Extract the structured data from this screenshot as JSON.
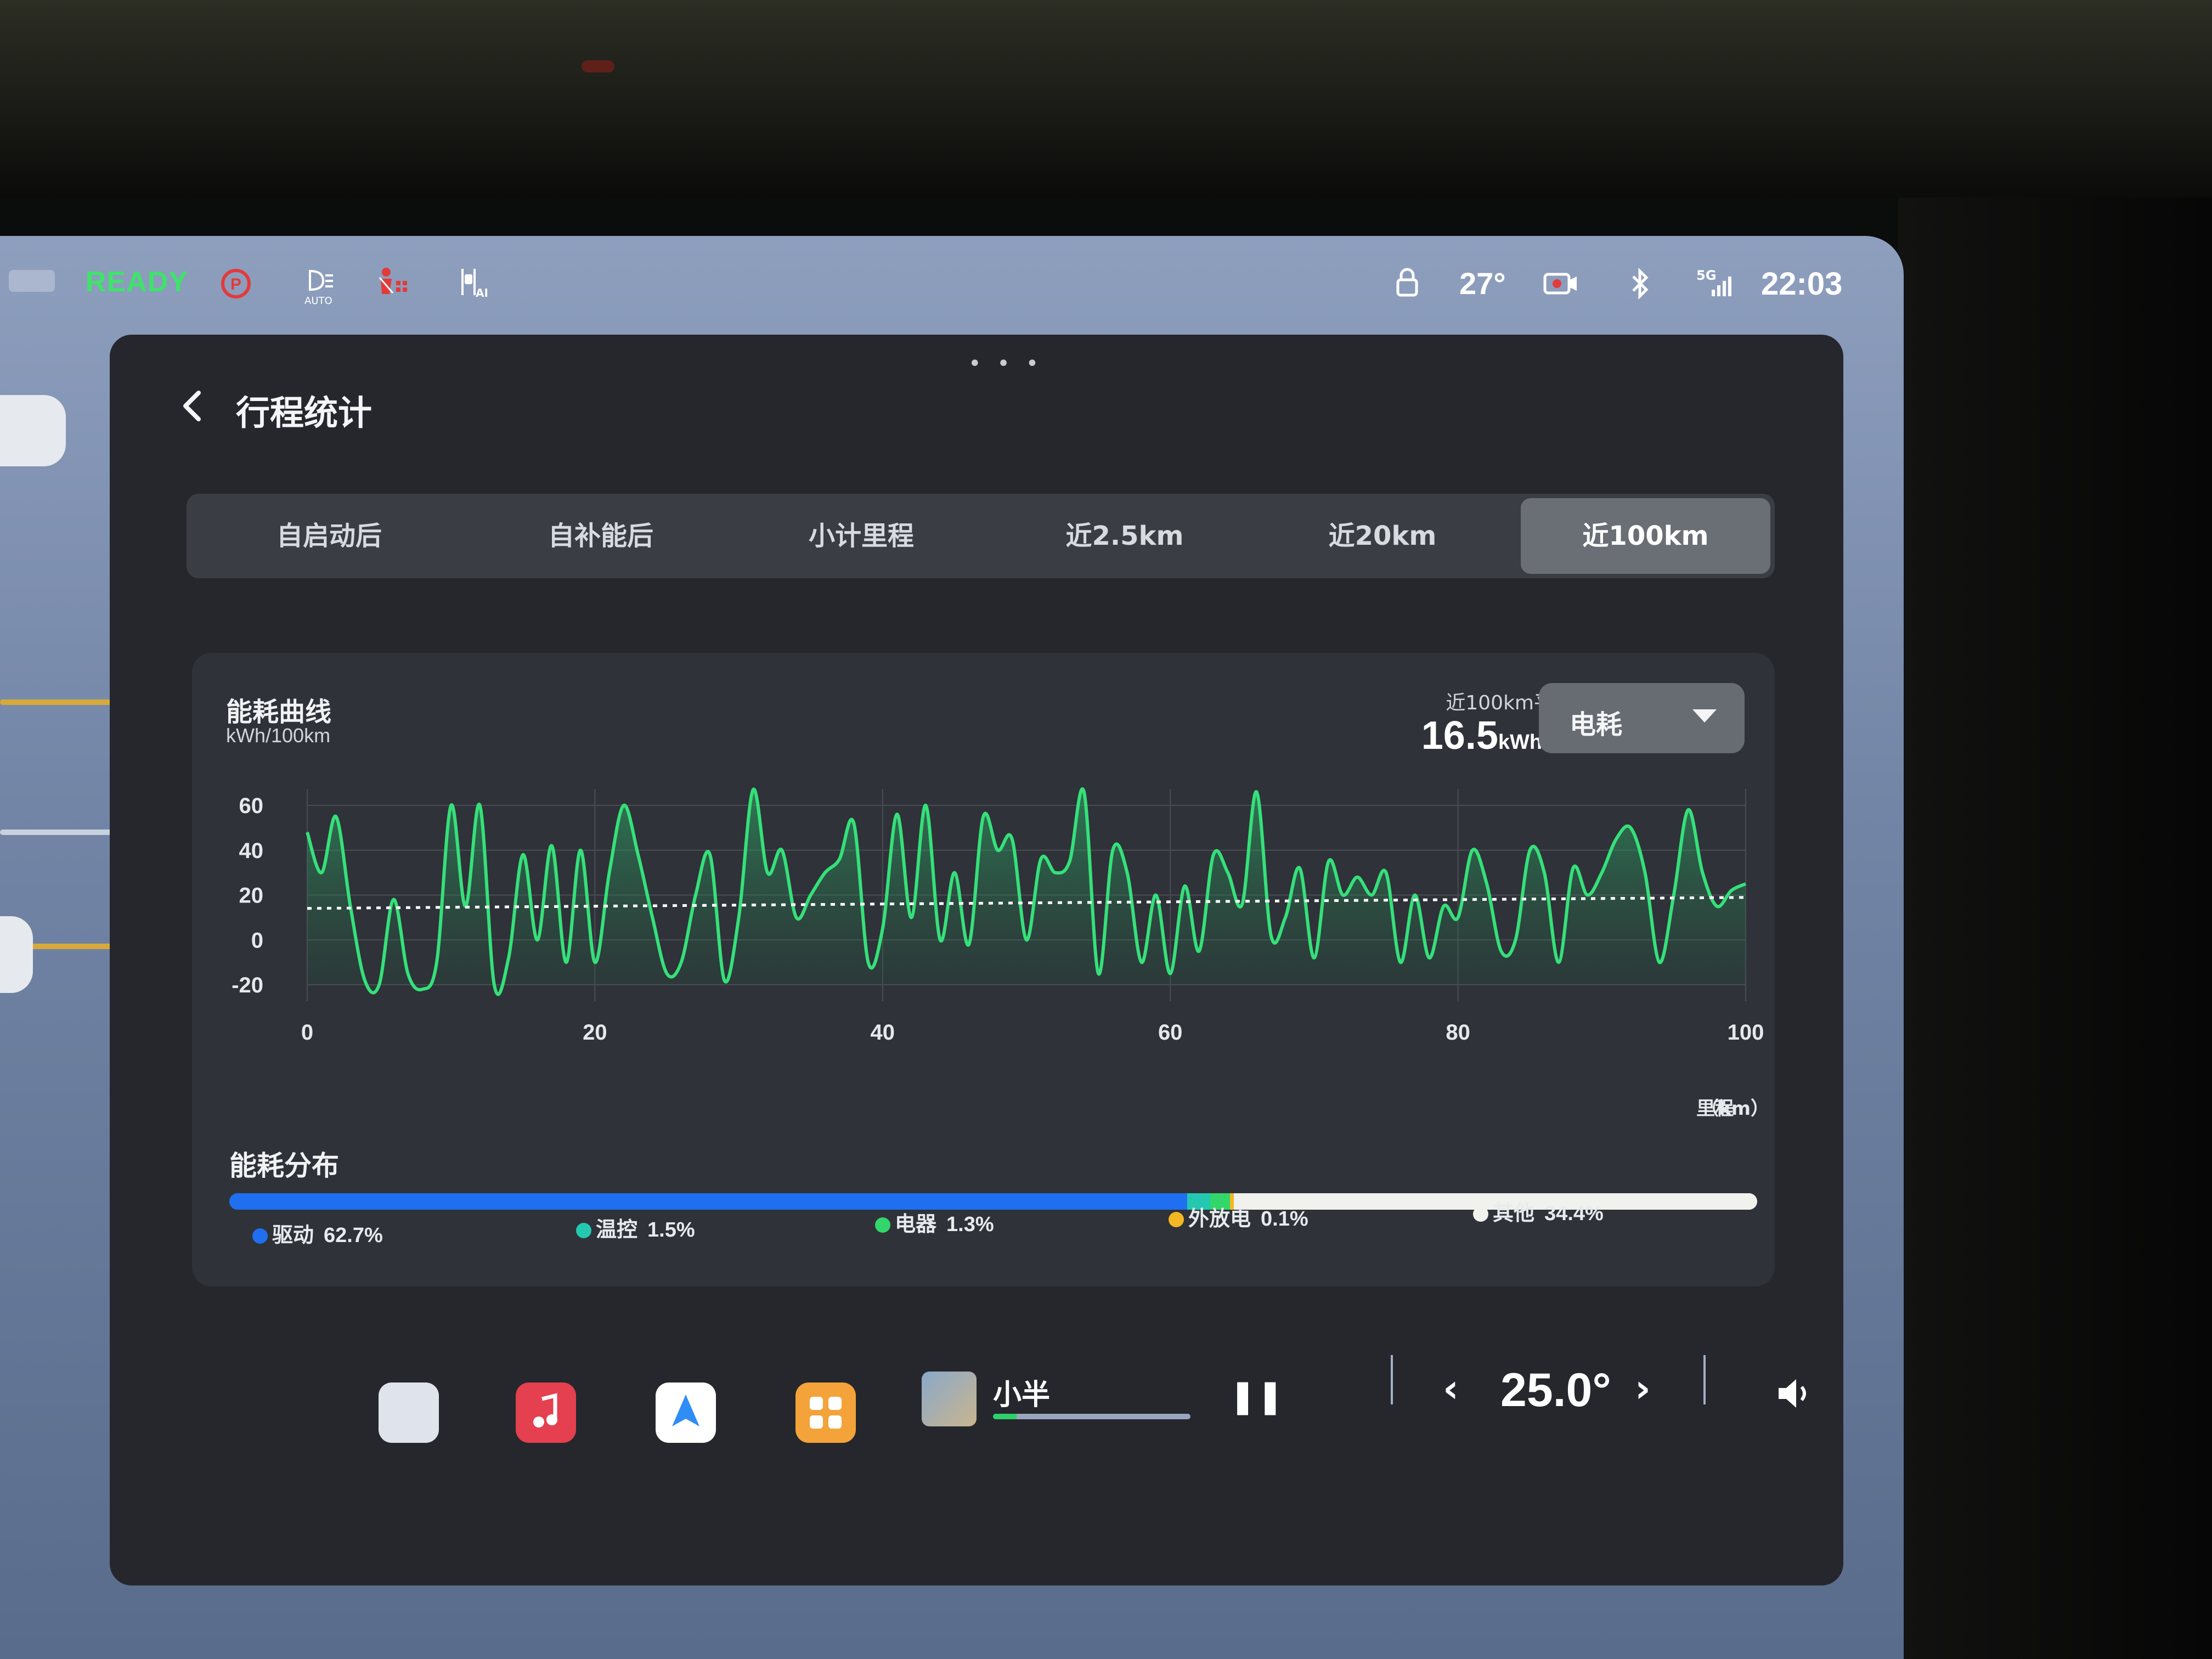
{
  "status_bar": {
    "ready": "READY",
    "park_icon": "park-brake-icon",
    "headlight_icon": "auto-headlight-icon",
    "headlight_badge": "AUTO",
    "seatbelt_icon": "seatbelt-warning-icon",
    "assist_icon": "driving-assist-icon",
    "assist_badge": "AI",
    "lock_icon": "lock-icon",
    "outside_temp": "27°",
    "camera_icon": "dashcam-icon",
    "bluetooth_icon": "bluetooth-icon",
    "signal_label": "5G",
    "clock": "22:03",
    "colors": {
      "ready": "#3fe36a",
      "park": "#e33a3a"
    }
  },
  "header": {
    "back_icon": "chevron-left-icon",
    "title": "行程统计"
  },
  "tabs": [
    {
      "label": "自启动后",
      "active": false
    },
    {
      "label": "自补能后",
      "active": false
    },
    {
      "label": "小计里程",
      "active": false
    },
    {
      "label": "近2.5km",
      "active": false
    },
    {
      "label": "近20km",
      "active": false
    },
    {
      "label": "近100km",
      "active": true
    }
  ],
  "energy_card": {
    "title": "能耗曲线",
    "unit": "kWh/100km",
    "avg_label": "近100km平均电耗",
    "avg_value": "16.5",
    "avg_unit": "kWh/100km",
    "dropdown": {
      "label": "电耗",
      "icon": "caret-down-icon"
    }
  },
  "chart_data": {
    "type": "area",
    "x_label": "里程（km）",
    "x_axis_title": "里程",
    "x_axis_unit": "（km）",
    "y_unit": "kWh/100km",
    "xlim": [
      0,
      100
    ],
    "ylim": [
      -20,
      60
    ],
    "x_ticks": [
      "0",
      "20",
      "40",
      "60",
      "80",
      "100"
    ],
    "y_ticks": [
      "60",
      "40",
      "20",
      "0",
      "-20"
    ],
    "average": 16.5,
    "line_color": "#35e07a",
    "x": [
      0,
      1,
      2,
      3,
      4,
      5,
      6,
      7,
      8,
      9,
      10,
      11,
      12,
      13,
      14,
      15,
      16,
      17,
      18,
      19,
      20,
      21,
      22,
      23,
      24,
      25,
      26,
      27,
      28,
      29,
      30,
      31,
      32,
      33,
      34,
      35,
      36,
      37,
      38,
      39,
      40,
      41,
      42,
      43,
      44,
      45,
      46,
      47,
      48,
      49,
      50,
      51,
      52,
      53,
      54,
      55,
      56,
      57,
      58,
      59,
      60,
      61,
      62,
      63,
      64,
      65,
      66,
      67,
      68,
      69,
      70,
      71,
      72,
      73,
      74,
      75,
      76,
      77,
      78,
      79,
      80,
      81,
      82,
      83,
      84,
      85,
      86,
      87,
      88,
      89,
      90,
      91,
      92,
      93,
      94,
      95,
      96,
      97,
      98,
      99,
      100
    ],
    "values": [
      48,
      30,
      55,
      15,
      -18,
      -20,
      18,
      -15,
      -22,
      -10,
      60,
      15,
      60,
      -20,
      -8,
      38,
      0,
      42,
      -10,
      40,
      -10,
      30,
      60,
      38,
      10,
      -15,
      -10,
      20,
      38,
      -18,
      10,
      67,
      30,
      40,
      10,
      20,
      30,
      36,
      52,
      -10,
      5,
      56,
      10,
      60,
      0,
      30,
      -2,
      55,
      40,
      45,
      0,
      36,
      30,
      35,
      66,
      -15,
      40,
      30,
      -10,
      20,
      -15,
      24,
      -5,
      38,
      30,
      16,
      66,
      2,
      10,
      32,
      -8,
      35,
      20,
      28,
      20,
      30,
      -10,
      20,
      -8,
      15,
      10,
      40,
      25,
      -5,
      0,
      40,
      30,
      -10,
      32,
      20,
      30,
      45,
      50,
      30,
      -10,
      20,
      58,
      30,
      15,
      22,
      25
    ]
  },
  "distribution": {
    "title": "能耗分布",
    "items": [
      {
        "label": "驱动",
        "pct": "62.7%",
        "value": 62.7,
        "color": "#1f6ff0"
      },
      {
        "label": "温控",
        "pct": "1.5%",
        "value": 1.5,
        "color": "#24c8b0"
      },
      {
        "label": "电器",
        "pct": "1.3%",
        "value": 1.3,
        "color": "#33d66a"
      },
      {
        "label": "外放电",
        "pct": "0.1%",
        "value": 0.1,
        "color": "#f2b824"
      },
      {
        "label": "其他",
        "pct": "34.4%",
        "value": 34.4,
        "color": "#f1f2ee"
      }
    ]
  },
  "dock": {
    "apps": [
      {
        "icon": "car-icon",
        "color": "#dfe4ec"
      },
      {
        "icon": "music-icon",
        "color": "#e5404f"
      },
      {
        "icon": "navigation-icon",
        "color": "#2f8df5"
      },
      {
        "icon": "app-grid-icon",
        "color": "#f3a33a"
      }
    ],
    "now_playing_title": "小半",
    "playback_progress": 0.12,
    "pause_icon": "pause-icon",
    "cabin_temp": "25.0°",
    "temp_down_icon": "chevron-left-icon",
    "temp_up_icon": "chevron-right-icon",
    "volume_icon": "speaker-icon"
  }
}
